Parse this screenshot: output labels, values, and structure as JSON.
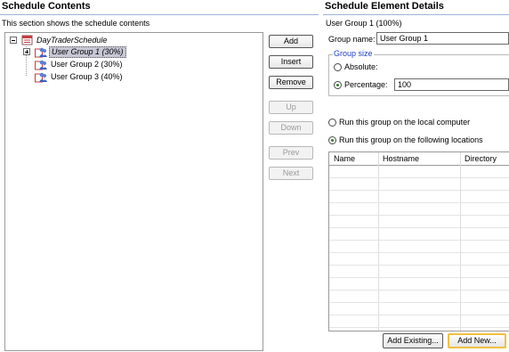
{
  "left": {
    "title": "Schedule Contents",
    "subtitle": "This section shows the schedule contents",
    "tree": {
      "root": {
        "label": "DayTraderSchedule",
        "icon": "schedule-icon",
        "expander": "minus"
      },
      "children": [
        {
          "label": "User Group 1 (30%)",
          "icon": "user-group-icon",
          "selected": true,
          "expander": "plus"
        },
        {
          "label": "User Group 2 (30%)",
          "icon": "user-group-icon",
          "selected": false
        },
        {
          "label": "User Group 3 (40%)",
          "icon": "user-group-icon",
          "selected": false
        }
      ]
    },
    "buttons": {
      "add": "Add",
      "insert": "Insert",
      "remove": "Remove",
      "up": "Up",
      "down": "Down",
      "prev": "Prev",
      "next": "Next"
    }
  },
  "right": {
    "title": "Schedule Element Details",
    "element_heading": "User Group 1 (100%)",
    "group_name_label": "Group name:",
    "group_name_value": "User Group 1",
    "group_size_legend": "Group size",
    "absolute_label": "Absolute:",
    "percentage_label": "Percentage:",
    "percentage_value": "100",
    "size_mode": "percentage",
    "run_local_label": "Run this group on the local computer",
    "run_locations_label": "Run this group on the following locations",
    "run_mode": "locations",
    "table": {
      "columns": [
        "Name",
        "Hostname",
        "Directory"
      ],
      "rows": []
    },
    "add_existing_label": "Add Existing...",
    "add_new_label": "Add New..."
  },
  "colors": {
    "section_rule": "#9fb3d6",
    "legend_text": "#1f3fbf",
    "selection_bg": "#c7c7d6",
    "default_button_border": "#f0c040"
  }
}
